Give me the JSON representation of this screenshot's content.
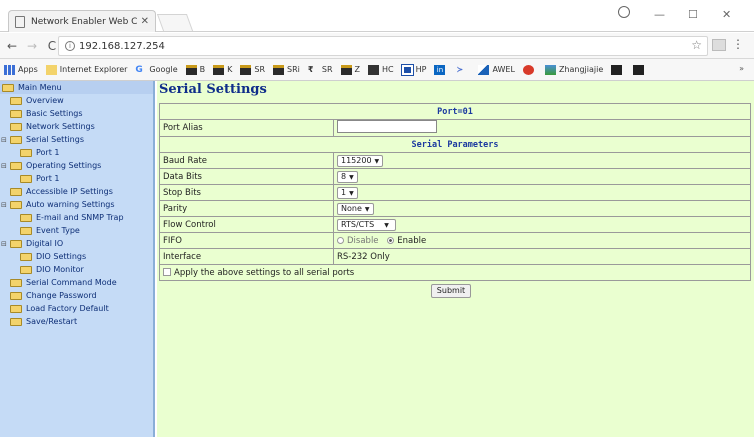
{
  "browser": {
    "tab_title": "Network Enabler Web Co",
    "url": "192.168.127.254",
    "bookmarks": [
      {
        "label": "Apps",
        "icon": "apps-grid-icon"
      },
      {
        "label": "Internet Explorer",
        "icon": "folder-icon"
      },
      {
        "label": "Google",
        "icon": "google-icon"
      },
      {
        "label": "B",
        "icon": "bank-icon"
      },
      {
        "label": "K",
        "icon": "bank-icon"
      },
      {
        "label": "SR",
        "icon": "bank-icon"
      },
      {
        "label": "SRi",
        "icon": "bank-icon"
      },
      {
        "label": "SR",
        "icon": "rupee-icon"
      },
      {
        "label": "Z",
        "icon": "bank-icon"
      },
      {
        "label": "HC",
        "icon": "mountain-icon"
      },
      {
        "label": "HP",
        "icon": "blue-square-icon"
      },
      {
        "label": "",
        "icon": "linkedin-icon"
      },
      {
        "label": "",
        "icon": "bird-icon"
      },
      {
        "label": "AWEL",
        "icon": "awel-icon"
      },
      {
        "label": "",
        "icon": "red-icon"
      },
      {
        "label": "Zhangjiajie",
        "icon": "photo-icon"
      },
      {
        "label": "",
        "icon": "dark-icon"
      },
      {
        "label": "",
        "icon": "dark-icon"
      }
    ],
    "more": "»"
  },
  "sidebar": {
    "items": [
      {
        "label": "Main Menu"
      },
      {
        "label": "Overview"
      },
      {
        "label": "Basic Settings"
      },
      {
        "label": "Network Settings"
      },
      {
        "label": "Serial Settings"
      },
      {
        "label": "Port 1"
      },
      {
        "label": "Operating Settings"
      },
      {
        "label": "Port 1"
      },
      {
        "label": "Accessible IP Settings"
      },
      {
        "label": "Auto warning Settings"
      },
      {
        "label": "E-mail and SNMP Trap"
      },
      {
        "label": "Event Type"
      },
      {
        "label": "Digital IO"
      },
      {
        "label": "DIO Settings"
      },
      {
        "label": "DIO Monitor"
      },
      {
        "label": "Serial Command Mode"
      },
      {
        "label": "Change Password"
      },
      {
        "label": "Load Factory Default"
      },
      {
        "label": "Save/Restart"
      }
    ]
  },
  "content": {
    "title": "Serial Settings",
    "port_header": "Port=01",
    "port_alias_label": "Port Alias",
    "serial_params_header": "Serial Parameters",
    "baud_rate_label": "Baud Rate",
    "baud_rate_value": "115200",
    "data_bits_label": "Data Bits",
    "data_bits_value": "8",
    "stop_bits_label": "Stop Bits",
    "stop_bits_value": "1",
    "parity_label": "Parity",
    "parity_value": "None",
    "flow_control_label": "Flow Control",
    "flow_control_value": "RTS/CTS",
    "fifo_label": "FIFO",
    "fifo_disable": "Disable",
    "fifo_enable": "Enable",
    "interface_label": "Interface",
    "interface_value": "RS-232 Only",
    "apply_all_label": "Apply the above settings to all serial ports",
    "submit_label": "Submit"
  }
}
